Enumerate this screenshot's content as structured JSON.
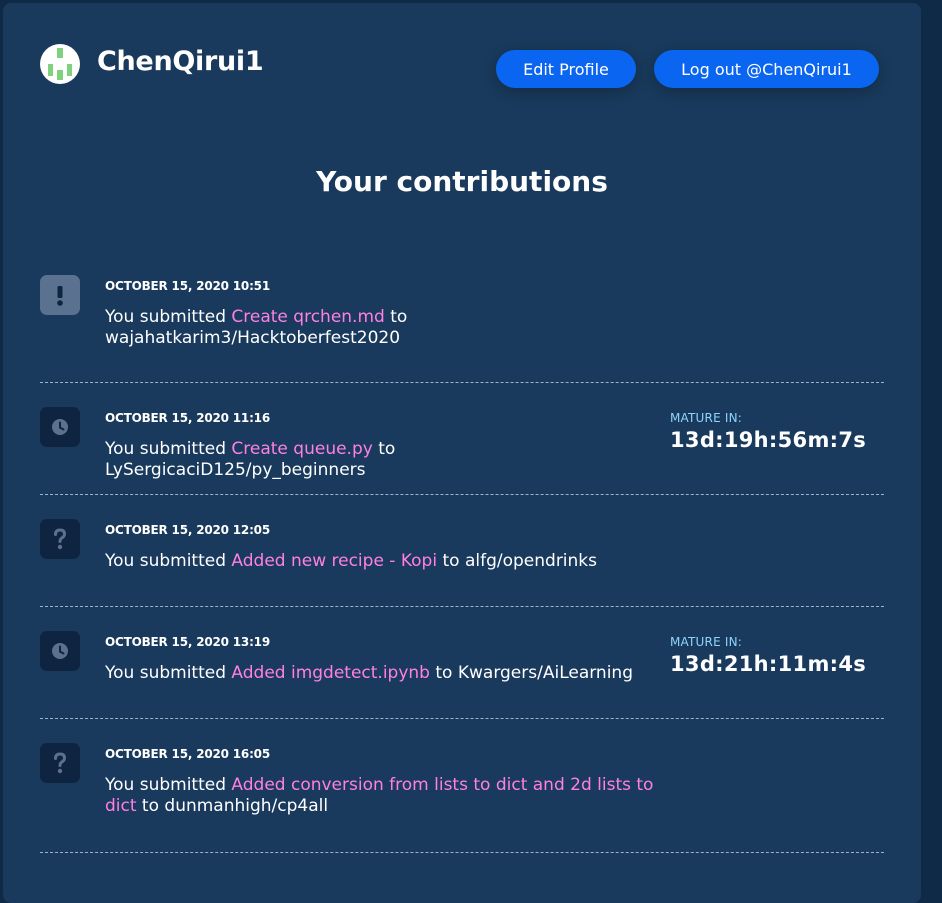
{
  "profile": {
    "username": "ChenQirui1",
    "edit_button": "Edit Profile",
    "logout_button": "Log out @ChenQirui1"
  },
  "page_title": "Your contributions",
  "contributions": [
    {
      "status_icon": "exclamation-icon",
      "date": "OCTOBER 15, 2020 10:51",
      "prefix": "You submitted ",
      "pr_title": "Create qrchen.md",
      "suffix": " to wajahatkarim3/Hacktoberfest2020"
    },
    {
      "status_icon": "clock-icon",
      "date": "OCTOBER 15, 2020 11:16",
      "prefix": "You submitted ",
      "pr_title": "Create queue.py",
      "suffix": " to LySergicaciD125/py_beginners",
      "mature_label": "MATURE IN:",
      "mature_value": "13d:19h:56m:7s"
    },
    {
      "status_icon": "question-icon",
      "date": "OCTOBER 15, 2020 12:05",
      "prefix": "You submitted ",
      "pr_title": "Added new recipe - Kopi",
      "suffix": " to alfg/opendrinks"
    },
    {
      "status_icon": "clock-icon",
      "date": "OCTOBER 15, 2020 13:19",
      "prefix": "You submitted ",
      "pr_title": "Added imgdetect.ipynb",
      "suffix": " to Kwargers/AiLearning",
      "mature_label": "MATURE IN:",
      "mature_value": "13d:21h:11m:4s"
    },
    {
      "status_icon": "question-icon",
      "date": "OCTOBER 15, 2020 16:05",
      "prefix": "You submitted ",
      "pr_title": "Added conversion from lists to dict and 2d lists to dict",
      "suffix": " to dunmanhigh/cp4all"
    }
  ],
  "colors": {
    "background": "#0f2a47",
    "card": "#193a5c",
    "button": "#0a66f0",
    "pr_link": "#ff80e0",
    "mature_label": "#8fd3ff"
  }
}
